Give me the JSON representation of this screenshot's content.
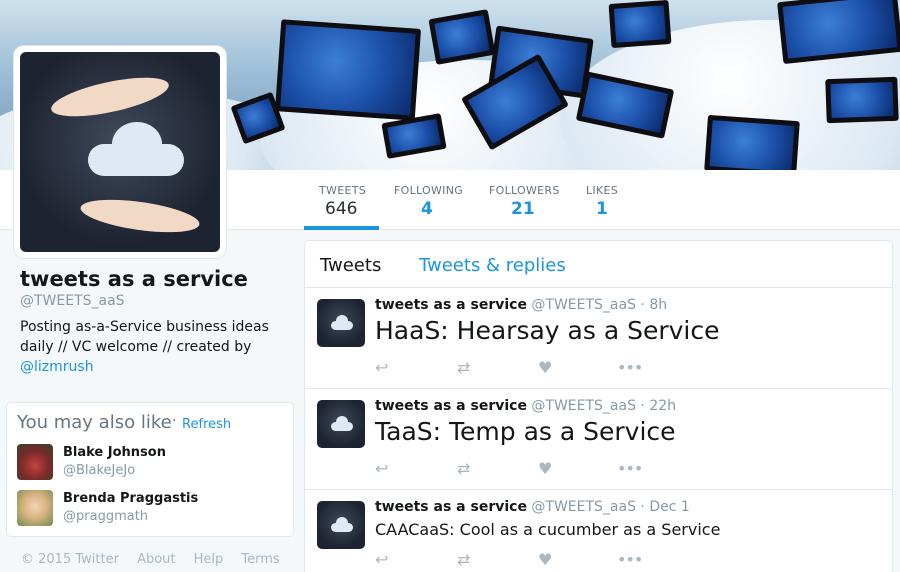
{
  "stats": {
    "tweets": {
      "label": "TWEETS",
      "value": "646"
    },
    "following": {
      "label": "FOLLOWING",
      "value": "4"
    },
    "followers": {
      "label": "FOLLOWERS",
      "value": "21"
    },
    "likes": {
      "label": "LIKES",
      "value": "1"
    }
  },
  "profile": {
    "name": "tweets as a service",
    "handle": "@TWEETS_aaS",
    "bio": "Posting as-a-Service business ideas daily // VC welcome // created by",
    "bio_link": "@lizmrush"
  },
  "who_to_follow": {
    "title": "You may also like",
    "separator": "·",
    "refresh": "Refresh",
    "users": [
      {
        "name": "Blake Johnson",
        "handle": "@BlakeJeJo"
      },
      {
        "name": "Brenda Praggastis",
        "handle": "@praggmath"
      }
    ]
  },
  "footer": {
    "copyright": "© 2015 Twitter",
    "about": "About",
    "help": "Help",
    "terms": "Terms"
  },
  "timeline": {
    "tabs": {
      "tweets": "Tweets",
      "replies": "Tweets & replies"
    },
    "tweets": [
      {
        "name": "tweets as a service",
        "handle": "@TWEETS_aaS",
        "sep": " · ",
        "time": "8h",
        "text": "HaaS: Hearsay as a Service"
      },
      {
        "name": "tweets as a service",
        "handle": "@TWEETS_aaS",
        "sep": " · ",
        "time": "22h",
        "text": "TaaS: Temp as a Service"
      },
      {
        "name": "tweets as a service",
        "handle": "@TWEETS_aaS",
        "sep": " · ",
        "time": "Dec 1",
        "text": "CAACaaS: Cool as a cucumber as a Service"
      }
    ]
  },
  "icons": {
    "reply": "reply-icon",
    "retweet": "retweet-icon",
    "like": "heart-icon",
    "more": "more-icon"
  },
  "colors": {
    "accent": "#1b95e0",
    "muted": "#8899a6"
  }
}
